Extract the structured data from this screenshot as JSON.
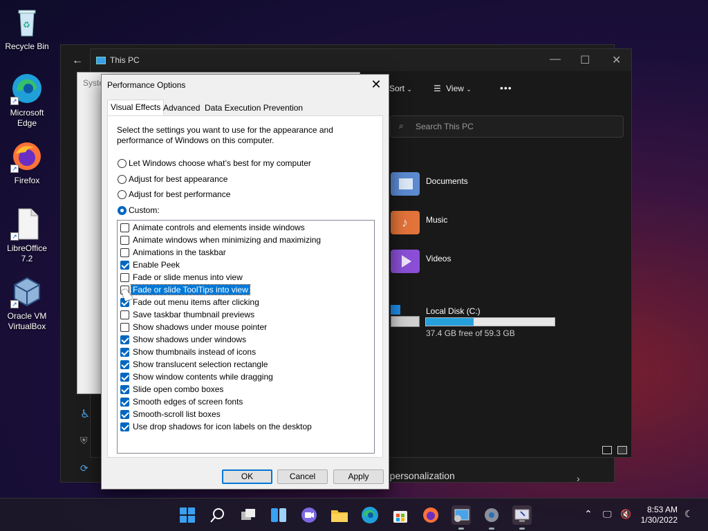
{
  "desktop": {
    "icons": [
      {
        "label": "Recycle Bin",
        "icon": "recycle-bin-icon"
      },
      {
        "label": "Microsoft Edge",
        "icon": "edge-icon"
      },
      {
        "label": "Firefox",
        "icon": "firefox-icon"
      },
      {
        "label": "LibreOffice 7.2",
        "icon": "libreoffice-icon"
      },
      {
        "label": "Oracle VM VirtualBox",
        "icon": "virtualbox-icon"
      }
    ]
  },
  "explorer": {
    "title": "This PC",
    "toolbar": {
      "sort": "Sort",
      "view": "View",
      "more": "•••"
    },
    "search_placeholder": "Search This PC",
    "folders": [
      {
        "name": "Documents",
        "color": "#5b8ad1"
      },
      {
        "name": "Music",
        "color": "#e2733a"
      },
      {
        "name": "Videos",
        "color": "#8a4fd6"
      }
    ],
    "drive": {
      "name": "Local Disk (C:)",
      "free_text": "37.4 GB free of 59.3 GB",
      "used_fraction": 0.37
    }
  },
  "settings_behind": {
    "text": "g personalization"
  },
  "sysprops": {
    "title": "Syste"
  },
  "dialog": {
    "title": "Performance Options",
    "tabs": [
      "Visual Effects",
      "Advanced",
      "Data Execution Prevention"
    ],
    "description": "Select the settings you want to use for the appearance and performance of Windows on this computer.",
    "options": [
      {
        "label": "Let Windows choose what’s best for my computer",
        "selected": false
      },
      {
        "label": "Adjust for best appearance",
        "selected": false
      },
      {
        "label": "Adjust for best performance",
        "selected": false
      },
      {
        "label": "Custom:",
        "selected": true
      }
    ],
    "effects": [
      {
        "label": "Animate controls and elements inside windows",
        "checked": false
      },
      {
        "label": "Animate windows when minimizing and maximizing",
        "checked": false
      },
      {
        "label": "Animations in the taskbar",
        "checked": false
      },
      {
        "label": "Enable Peek",
        "checked": true
      },
      {
        "label": "Fade or slide menus into view",
        "checked": false
      },
      {
        "label": "Fade or slide ToolTips into view",
        "checked": false,
        "focused": true
      },
      {
        "label": "Fade out menu items after clicking",
        "checked": true
      },
      {
        "label": "Save taskbar thumbnail previews",
        "checked": false
      },
      {
        "label": "Show shadows under mouse pointer",
        "checked": false
      },
      {
        "label": "Show shadows under windows",
        "checked": true
      },
      {
        "label": "Show thumbnails instead of icons",
        "checked": true
      },
      {
        "label": "Show translucent selection rectangle",
        "checked": true
      },
      {
        "label": "Show window contents while dragging",
        "checked": true
      },
      {
        "label": "Slide open combo boxes",
        "checked": true
      },
      {
        "label": "Smooth edges of screen fonts",
        "checked": true
      },
      {
        "label": "Smooth-scroll list boxes",
        "checked": true
      },
      {
        "label": "Use drop shadows for icon labels on the desktop",
        "checked": true
      }
    ],
    "buttons": {
      "ok": "OK",
      "cancel": "Cancel",
      "apply": "Apply"
    }
  },
  "taskbar": {
    "apps": [
      "start-icon",
      "search-icon",
      "task-view-icon",
      "widgets-icon",
      "teams-chat-icon",
      "file-explorer-icon",
      "edge-icon",
      "store-icon",
      "firefox-icon",
      "control-panel-icon",
      "settings-icon",
      "system-properties-icon"
    ],
    "time": "8:53 AM",
    "date": "1/30/2022"
  }
}
